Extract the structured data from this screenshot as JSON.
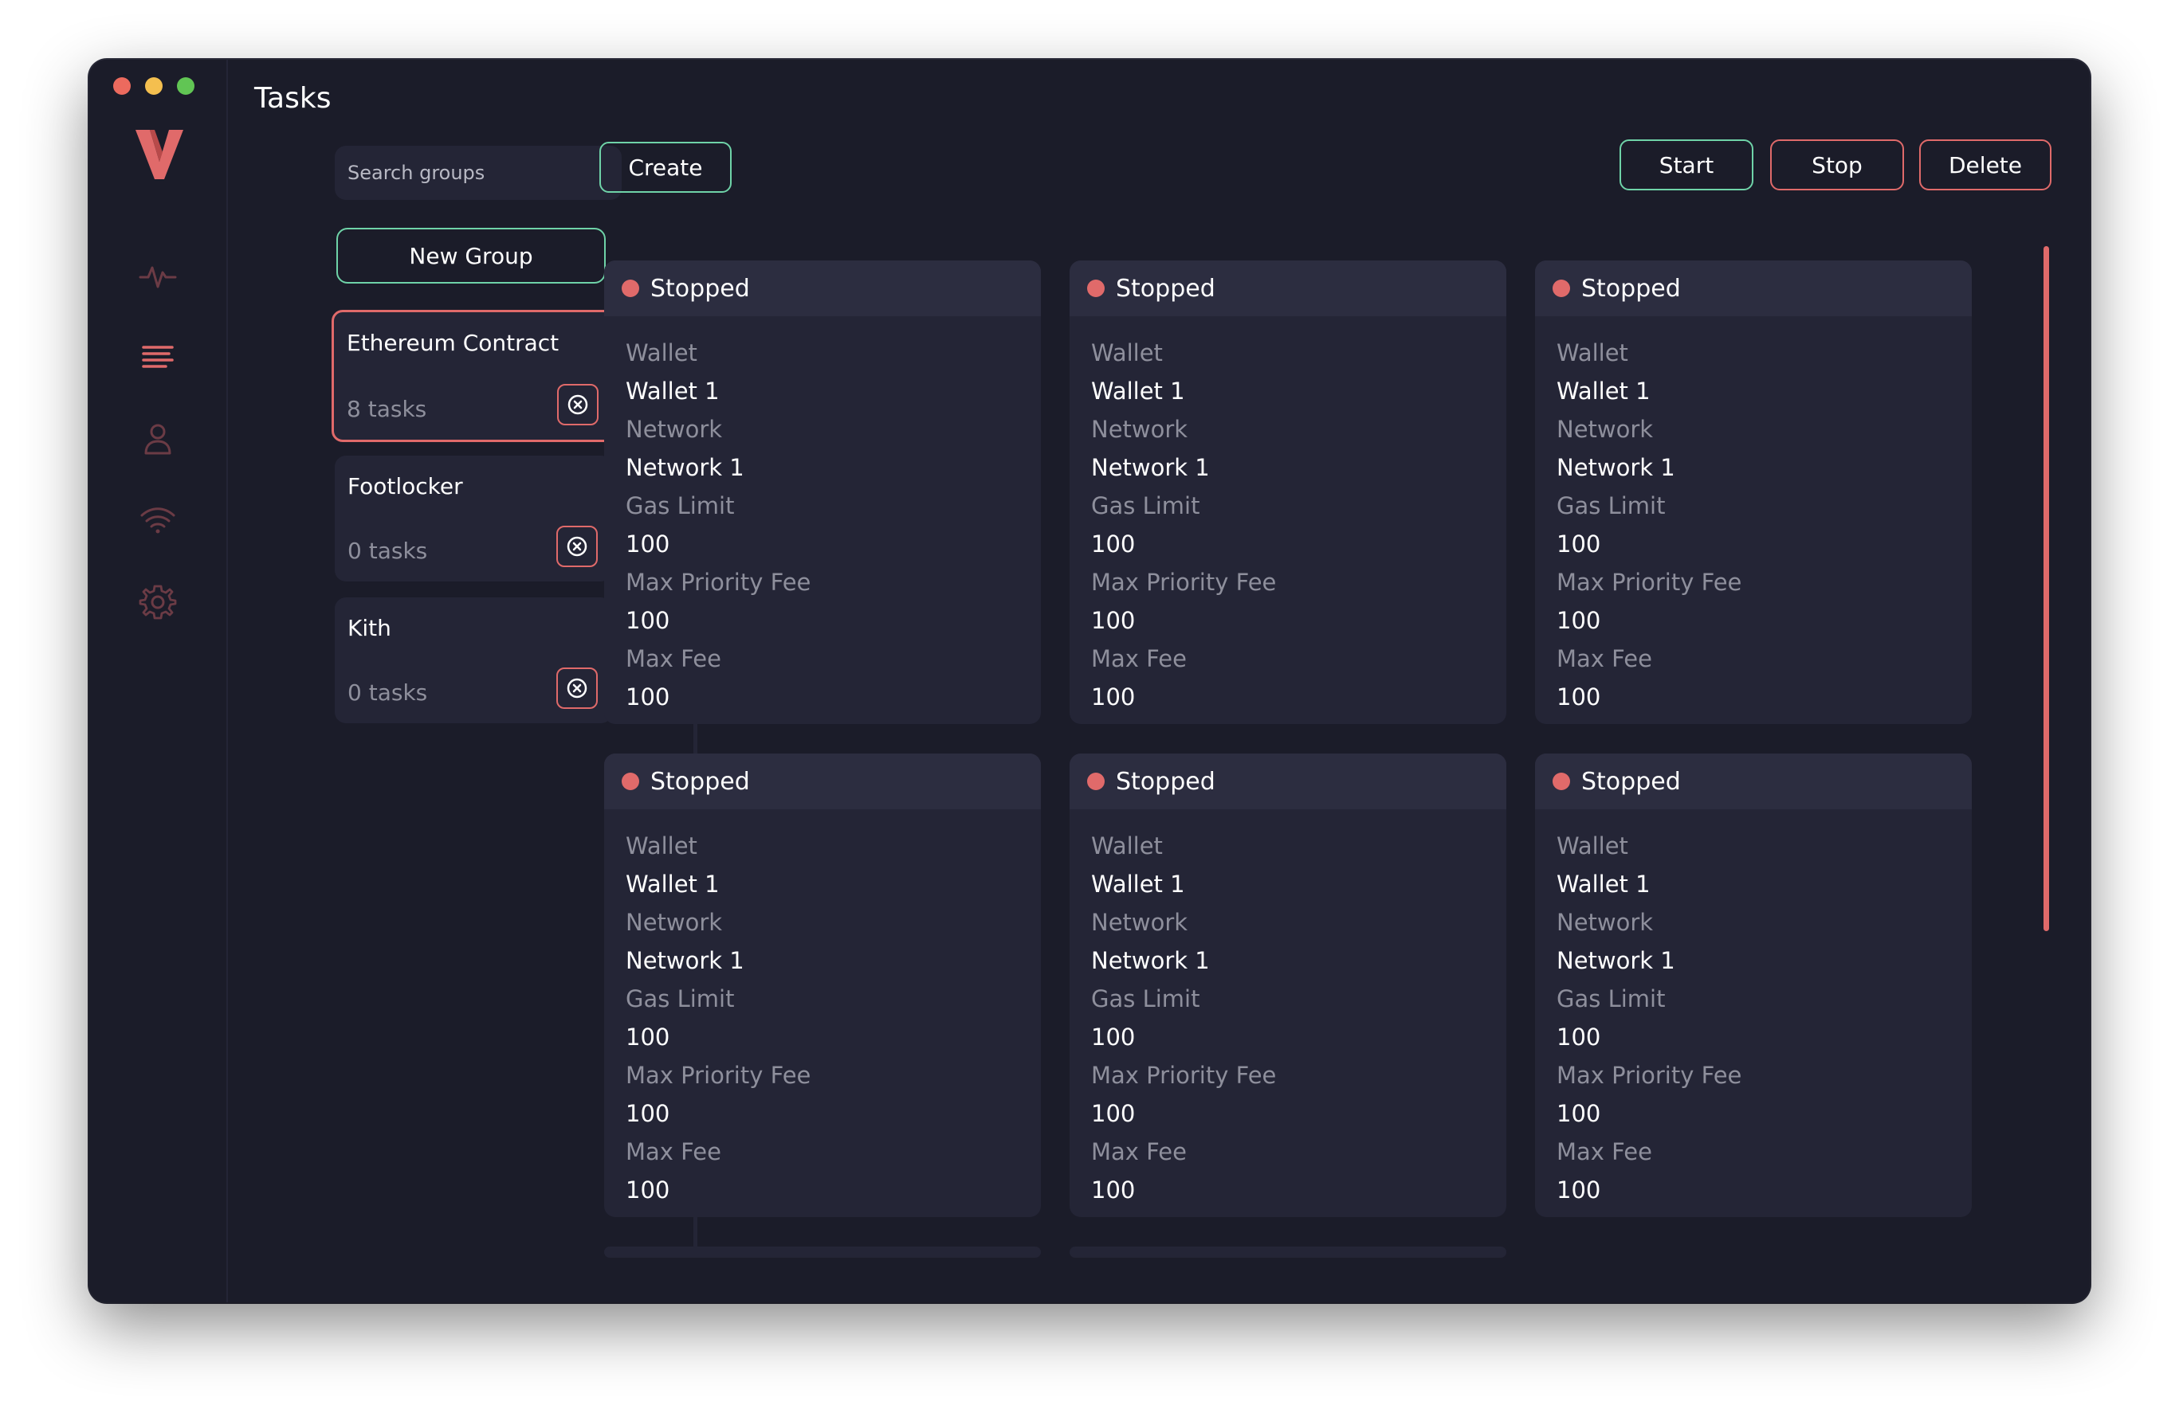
{
  "window": {
    "title": "Tasks",
    "traffic_lights": [
      "#ec6a5e",
      "#f4bf4f",
      "#61c554"
    ]
  },
  "nav": {
    "logo": "v-logo",
    "items": [
      {
        "icon": "activity-icon",
        "active": false
      },
      {
        "icon": "tasks-list-icon",
        "active": true
      },
      {
        "icon": "user-icon",
        "active": false
      },
      {
        "icon": "wifi-icon",
        "active": false
      },
      {
        "icon": "gear-icon",
        "active": false
      }
    ]
  },
  "groups": {
    "search_placeholder": "Search groups",
    "new_group_label": "New Group",
    "items": [
      {
        "name": "Ethereum Contract",
        "count": "8 tasks",
        "active": true
      },
      {
        "name": "Footlocker",
        "count": "0 tasks",
        "active": false
      },
      {
        "name": "Kith",
        "count": "0 tasks",
        "active": false
      }
    ]
  },
  "toolbar": {
    "create_label": "Create",
    "start_label": "Start",
    "stop_label": "Stop",
    "delete_label": "Delete"
  },
  "tasks": [
    {
      "status": "Stopped",
      "wallet_label": "Wallet",
      "wallet": "Wallet 1",
      "network_label": "Network",
      "network": "Network 1",
      "gas_label": "Gas Limit",
      "gas": "100",
      "mpf_label": "Max Priority Fee",
      "mpf": "100",
      "maxfee_label": "Max Fee",
      "maxfee": "100"
    },
    {
      "status": "Stopped",
      "wallet_label": "Wallet",
      "wallet": "Wallet 1",
      "network_label": "Network",
      "network": "Network 1",
      "gas_label": "Gas Limit",
      "gas": "100",
      "mpf_label": "Max Priority Fee",
      "mpf": "100",
      "maxfee_label": "Max Fee",
      "maxfee": "100"
    },
    {
      "status": "Stopped",
      "wallet_label": "Wallet",
      "wallet": "Wallet 1",
      "network_label": "Network",
      "network": "Network 1",
      "gas_label": "Gas Limit",
      "gas": "100",
      "mpf_label": "Max Priority Fee",
      "mpf": "100",
      "maxfee_label": "Max Fee",
      "maxfee": "100"
    },
    {
      "status": "Stopped",
      "wallet_label": "Wallet",
      "wallet": "Wallet 1",
      "network_label": "Network",
      "network": "Network 1",
      "gas_label": "Gas Limit",
      "gas": "100",
      "mpf_label": "Max Priority Fee",
      "mpf": "100",
      "maxfee_label": "Max Fee",
      "maxfee": "100"
    },
    {
      "status": "Stopped",
      "wallet_label": "Wallet",
      "wallet": "Wallet 1",
      "network_label": "Network",
      "network": "Network 1",
      "gas_label": "Gas Limit",
      "gas": "100",
      "mpf_label": "Max Priority Fee",
      "mpf": "100",
      "maxfee_label": "Max Fee",
      "maxfee": "100"
    },
    {
      "status": "Stopped",
      "wallet_label": "Wallet",
      "wallet": "Wallet 1",
      "network_label": "Network",
      "network": "Network 1",
      "gas_label": "Gas Limit",
      "gas": "100",
      "mpf_label": "Max Priority Fee",
      "mpf": "100",
      "maxfee_label": "Max Fee",
      "maxfee": "100"
    }
  ],
  "colors": {
    "accent_red": "#e06a6a",
    "accent_green": "#6fd3a8",
    "bg": "#1b1c29",
    "card": "#242536"
  }
}
